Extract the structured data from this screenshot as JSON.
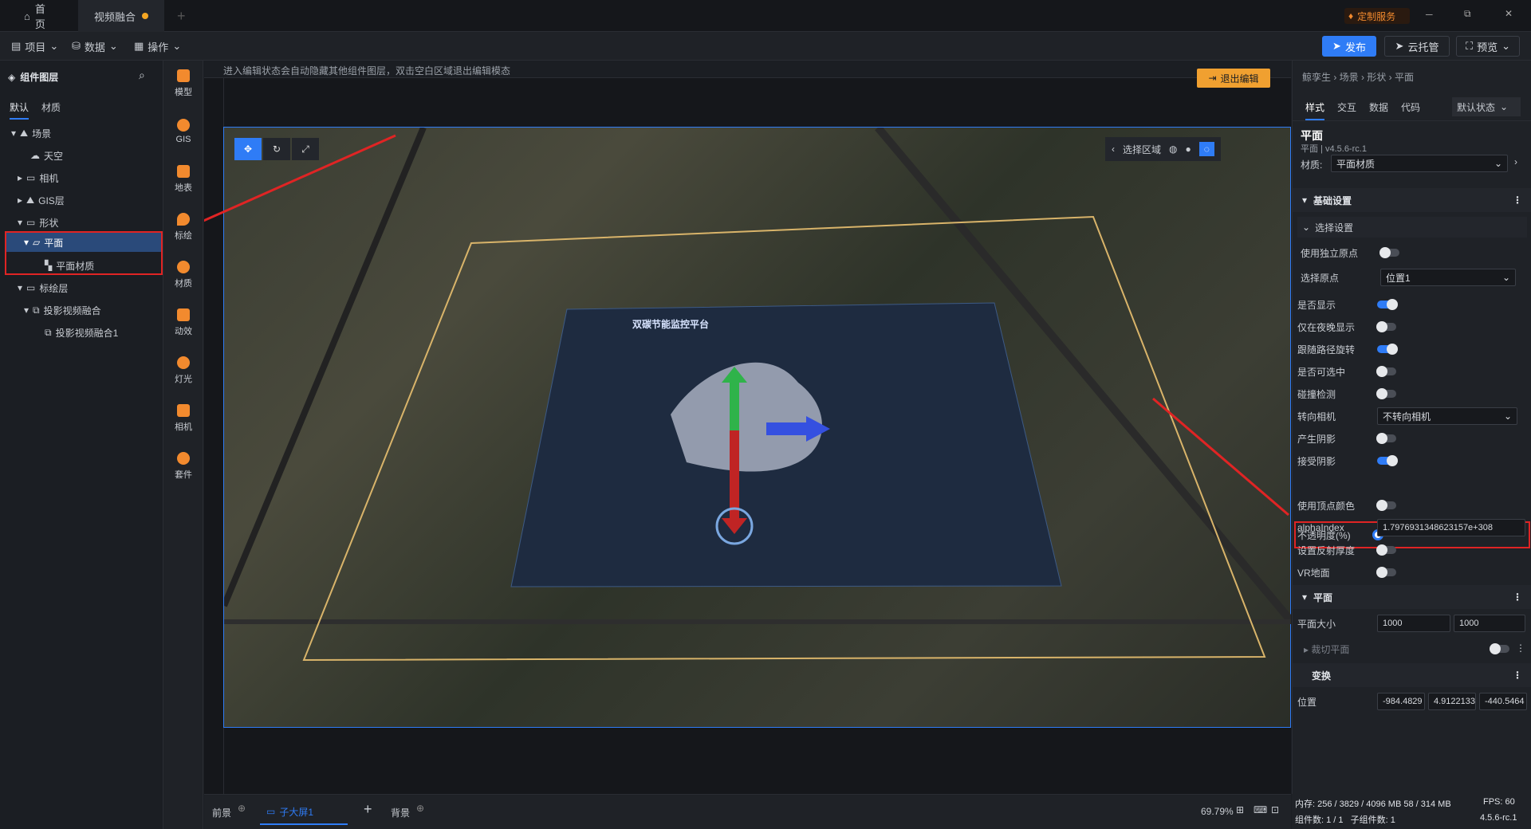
{
  "titlebar": {
    "home_tab": "首页",
    "active_tab": "视频融合",
    "add_tab": "+",
    "custom_service": "定制服务",
    "minimize": "─",
    "restore": "⧉",
    "close": "✕"
  },
  "menubar": {
    "project": "项目",
    "data": "数据",
    "operate": "操作",
    "publish": "发布",
    "cloud_host": "云托管",
    "preview": "预览"
  },
  "layers": {
    "title": "组件图层",
    "tab_default": "默认",
    "tab_material": "材质",
    "items": [
      {
        "label": "场景"
      },
      {
        "label": "天空"
      },
      {
        "label": "相机"
      },
      {
        "label": "GIS层"
      },
      {
        "label": "形状"
      },
      {
        "label": "平面"
      },
      {
        "label": "平面材质"
      },
      {
        "label": "标绘层"
      },
      {
        "label": "投影视频融合"
      },
      {
        "label": "投影视频融合1"
      }
    ]
  },
  "tools": [
    {
      "label": "模型"
    },
    {
      "label": "GIS"
    },
    {
      "label": "地表"
    },
    {
      "label": "标绘"
    },
    {
      "label": "材质"
    },
    {
      "label": "动效"
    },
    {
      "label": "灯光"
    },
    {
      "label": "相机"
    },
    {
      "label": "套件"
    }
  ],
  "canvas": {
    "hint": "进入编辑状态会自动隐藏其他组件图层，双击空白区域退出编辑模态",
    "exit_edit": "退出编辑",
    "select_region": "选择区域",
    "dashboard_title": "双碳节能监控平台"
  },
  "breadcrumb": {
    "path": "鲸孪生 › 场景 › 形状 › 平面"
  },
  "props": {
    "tabs": [
      "样式",
      "交互",
      "数据",
      "代码"
    ],
    "state_select": "默认状态",
    "component_name": "平面",
    "component_version": "平面 | v4.5.6-rc.1",
    "material_label": "材质:",
    "material_value": "平面材质",
    "basic_settings": "基础设置",
    "select_settings": "选择设置",
    "use_own_origin": "使用独立原点",
    "select_origin": "选择原点",
    "origin_value": "位置1",
    "visible": "是否显示",
    "night_only": "仅在夜晚显示",
    "follow_path": "跟随路径旋转",
    "selectable": "是否可选中",
    "collision": "碰撞检测",
    "face_camera": "转向相机",
    "face_camera_value": "不转向相机",
    "cast_shadow": "产生阴影",
    "receive_shadow": "接受阴影",
    "opacity": "不透明度(%)",
    "opacity_value": 0,
    "vertex_color": "使用顶点颜色",
    "alpha_index_label": "alphaIndex",
    "alpha_index_value": "1.7976931348623157e+308",
    "reflect_thickness": "设置反射厚度",
    "vr_ground": "VR地面",
    "plane_section": "平面",
    "plane_size": "平面大小",
    "plane_w": "1000",
    "plane_h": "1000",
    "clip_plane": "裁切平面",
    "transform": "变换",
    "position": "位置",
    "pos_x": "-984.4829",
    "pos_y": "4.9122133",
    "pos_z": "-440.5464"
  },
  "toggles": {
    "use_own_origin": false,
    "visible": true,
    "night_only": false,
    "follow_path": true,
    "selectable": false,
    "collision": false,
    "cast_shadow": false,
    "receive_shadow": true,
    "vertex_color": false,
    "reflect_thickness": false,
    "vr_ground": false,
    "clip_plane": false
  },
  "bottom": {
    "foreground": "前景",
    "sub_screen": "子大屏1",
    "background": "背景",
    "zoom": "69.79%"
  },
  "status": {
    "memory": "内存: 256 / 3829 / 4096 MB 58 / 314 MB",
    "fps": "FPS: 60",
    "counts": "组件数: 1 / 1   子组件数: 1",
    "version": "4.5.6-rc.1"
  },
  "colors": {
    "accent": "#2f7cf6",
    "highlight": "#e02424",
    "exit": "#f0a030"
  }
}
